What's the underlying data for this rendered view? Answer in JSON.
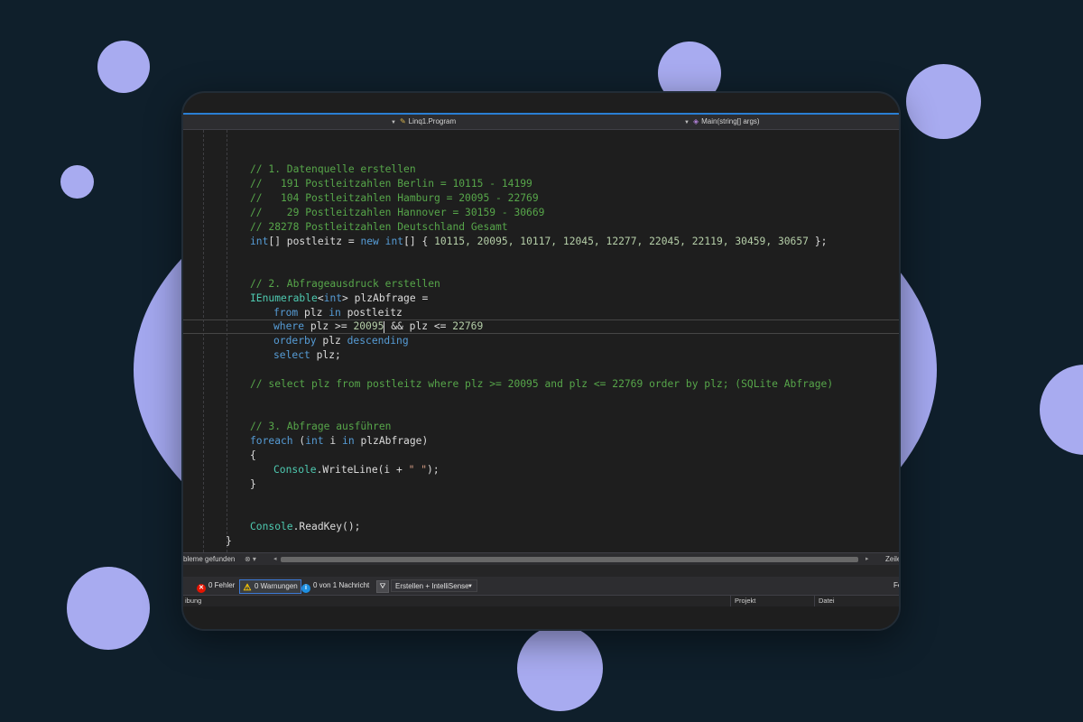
{
  "nav": {
    "type_scope": "Linq1.Program",
    "member_scope": "Main(string[] args)"
  },
  "code": {
    "l1": "// 1. Datenquelle erstellen",
    "l2": "//   191 Postleitzahlen Berlin = 10115 - 14199",
    "l3": "//   104 Postleitzahlen Hamburg = 20095 - 22769",
    "l4": "//    29 Postleitzahlen Hannover = 30159 - 30669",
    "l5": "// 28278 Postleitzahlen Deutschland Gesamt",
    "l6_kw1": "int",
    "l6_a": "[] postleitz = ",
    "l6_kw2": "new",
    "l6_b": " ",
    "l6_kw3": "int",
    "l6_c": "[] { ",
    "l6_nums": "10115, 20095, 10117, 12045, 12277, 22045, 22119, 30459, 30657",
    "l6_d": " };",
    "l7": "// 2. Abfrageausdruck erstellen",
    "l8_type": "IEnumerable",
    "l8_a": "<",
    "l8_kw": "int",
    "l8_b": "> plzAbfrage =",
    "l9_kw1": "from",
    "l9_a": " plz ",
    "l9_kw2": "in",
    "l9_b": " postleitz",
    "l10_kw": "where",
    "l10_a": " plz >= ",
    "l10_n1": "20095",
    "l10_b": " && plz <= ",
    "l10_n2": "22769",
    "l11_kw1": "orderby",
    "l11_a": " plz ",
    "l11_kw2": "descending",
    "l12_kw": "select",
    "l12_a": " plz;",
    "l13": "// select plz from postleitz where plz >= 20095 and plz <= 22769 order by plz; (SQLite Abfrage)",
    "l14": "// 3. Abfrage ausführen",
    "l15_kw1": "foreach",
    "l15_a": " (",
    "l15_kw2": "int",
    "l15_b": " i ",
    "l15_kw3": "in",
    "l15_c": " plzAbfrage)",
    "l16": "{",
    "l17_type": "Console",
    "l17_a": ".WriteLine(i + ",
    "l17_str": "\" \"",
    "l17_b": ");",
    "l18": "}",
    "l19_type": "Console",
    "l19_a": ".ReadKey();",
    "l20": "}"
  },
  "hscroll": {
    "status": "bleme gefunden",
    "zeile": "Zeile"
  },
  "errorlist": {
    "errors": "0 Fehler",
    "warnings": "0 Warnungen",
    "messages": "0 von 1 Nachricht",
    "scope": "Erstellen + IntelliSense",
    "right_label": "Fe",
    "col_description": "ibung",
    "col_project": "Projekt",
    "col_file": "Datei"
  },
  "colors": {
    "background": "#0f1f2b",
    "blob": "#a8abf0",
    "editor_bg": "#1e1e1e",
    "comment": "#57a64a",
    "keyword": "#569cd6",
    "type": "#4ec9b0",
    "accent": "#2a7fd4"
  }
}
